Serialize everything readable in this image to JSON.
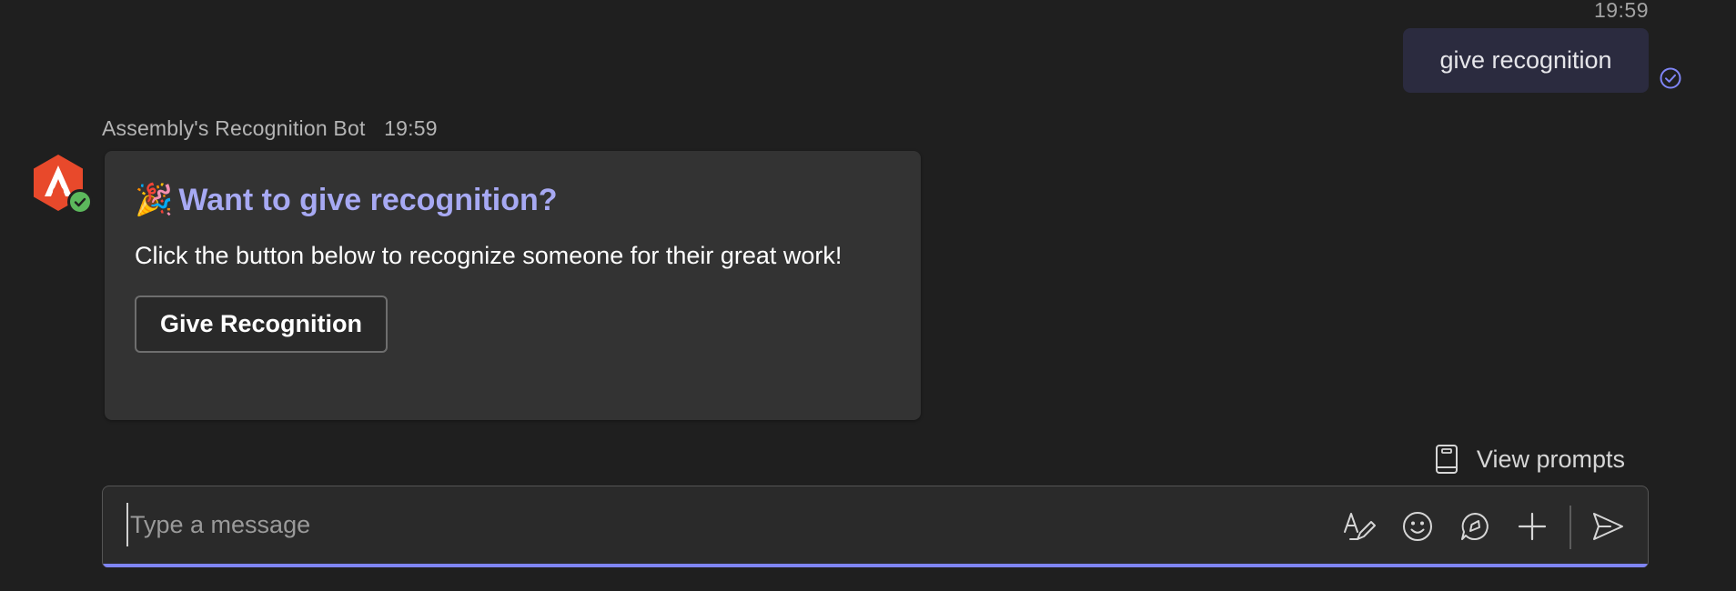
{
  "outgoing_message": {
    "time": "19:59",
    "text": "give recognition",
    "status_icon": "sent-check-icon"
  },
  "bot_message": {
    "sender": "Assembly's Recognition Bot",
    "time": "19:59",
    "avatar_icon": "assembly-logo-icon",
    "card": {
      "emoji": "🎉",
      "title": "Want to give recognition?",
      "body": "Click the button below to recognize someone for their great work!",
      "button_label": "Give Recognition"
    }
  },
  "view_prompts": {
    "label": "View prompts",
    "icon": "book-icon"
  },
  "compose": {
    "placeholder": "Type a message",
    "tools": [
      "format-icon",
      "emoji-icon",
      "loop-icon",
      "plus-icon",
      "send-icon"
    ]
  },
  "colors": {
    "background": "#1f1f1f",
    "accent": "#7f85f5",
    "title": "#a7a9f3",
    "card": "#333333",
    "logo": "#e8492b",
    "presence": "#5cb85c"
  }
}
